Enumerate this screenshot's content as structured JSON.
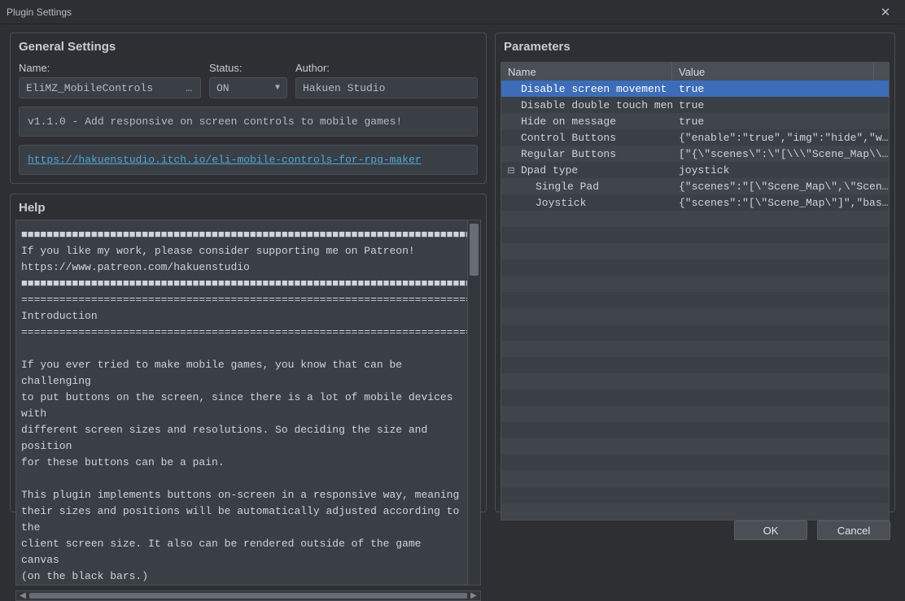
{
  "window": {
    "title": "Plugin Settings"
  },
  "general": {
    "title": "General Settings",
    "name_label": "Name:",
    "status_label": "Status:",
    "author_label": "Author:",
    "name_value": "EliMZ_MobileControls",
    "status_value": "ON",
    "author_value": "Hakuen Studio",
    "description": "v1.1.0 - Add responsive on screen controls to mobile games!",
    "link_text": "https://hakuenstudio.itch.io/eli-mobile-controls-for-rpg-maker",
    "link_href": "#"
  },
  "help": {
    "title": "Help",
    "text": "■■■■■■■■■■■■■■■■■■■■■■■■■■■■■■■■■■■■■■■■■■■■■■■■■■■■■■■■■■■■■■■■■■■■■■■■■■■\nIf you like my work, please consider supporting me on Patreon!\nhttps://www.patreon.com/hakuenstudio\n■■■■■■■■■■■■■■■■■■■■■■■■■■■■■■■■■■■■■■■■■■■■■■■■■■■■■■■■■■■■■■■■■■■■■■■■■■■\n============================================================================\nIntroduction\n============================================================================\n\nIf you ever tried to make mobile games, you know that can be challenging\nto put buttons on the screen, since there is a lot of mobile devices with\ndifferent screen sizes and resolutions. So deciding the size and position\nfor these buttons can be a pain.\n\nThis plugin implements buttons on-screen in a responsive way, meaning\ntheir sizes and positions will be automatically adjusted according to the\nclient screen size. It also can be rendered outside of the game canvas\n(on the black bars.)"
  },
  "parameters": {
    "title": "Parameters",
    "columns": {
      "name": "Name",
      "value": "Value"
    },
    "rows": [
      {
        "name": "Disable screen movement",
        "value": "true",
        "selected": true
      },
      {
        "name": "Disable double touch menu",
        "value": "true"
      },
      {
        "name": "Hide on message",
        "value": "true"
      },
      {
        "name": "Control Buttons",
        "value": "{\"enable\":\"true\",\"img\":\"hide\",\"w…"
      },
      {
        "name": "Regular Buttons",
        "value": "[\"{\\\"scenes\\\":\\\"[\\\\\\\"Scene_Map\\\\…"
      },
      {
        "name": "Dpad type",
        "value": "joystick",
        "expandable": true
      },
      {
        "name": "Single Pad",
        "value": "{\"scenes\":\"[\\\"Scene_Map\\\",\\\"Scen…",
        "child": true
      },
      {
        "name": "Joystick",
        "value": "{\"scenes\":\"[\\\"Scene_Map\\\"]\",\"bas…",
        "child": true
      }
    ]
  },
  "buttons": {
    "ok": "OK",
    "cancel": "Cancel"
  }
}
